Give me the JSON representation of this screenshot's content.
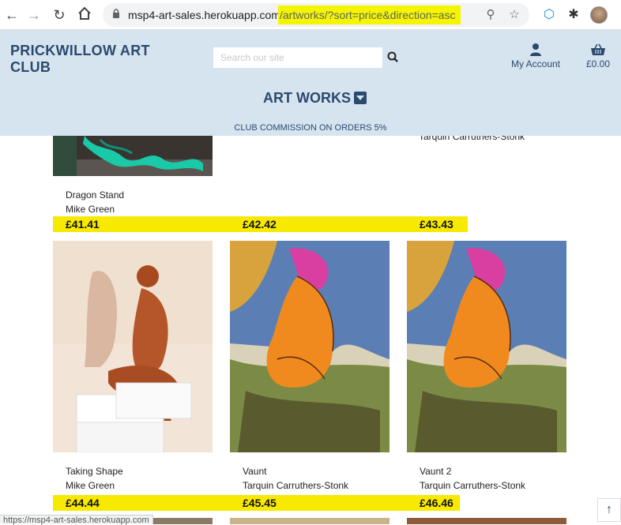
{
  "browser": {
    "url_host": "msp4-art-sales.herokuapp.com",
    "url_path": "/artworks/?sort=price&direction=asc",
    "status_url": "https://msp4-art-sales.herokuapp.com"
  },
  "header": {
    "logo": "PRICKWILLOW ART CLUB",
    "search_placeholder": "Search our site",
    "account_label": "My Account",
    "cart_total": "£0.00",
    "menu_label": "ART WORKS",
    "commission_banner": "CLUB COMMISSION ON ORDERS 5%"
  },
  "row1": {
    "partial_artist": "Tarquin Carruthers-Stonk",
    "cards": [
      {
        "title": "Dragon Stand",
        "artist": "Mike Green",
        "price": "£41.41"
      },
      {
        "title": "",
        "artist": "",
        "price": "£42.42"
      },
      {
        "title": "",
        "artist": "",
        "price": "£43.43"
      }
    ]
  },
  "row2": {
    "cards": [
      {
        "title": "Taking Shape",
        "artist": "Mike Green",
        "price": "£44.44"
      },
      {
        "title": "Vaunt",
        "artist": "Tarquin Carruthers-Stonk",
        "price": "£45.45"
      },
      {
        "title": "Vaunt 2",
        "artist": "Tarquin Carruthers-Stonk",
        "price": "£46.46"
      }
    ]
  },
  "colors": {
    "header_bg": "#d6e4f0",
    "brand_blue": "#2b4a6e",
    "price_highlight": "#f7ea00",
    "url_highlight": "#f5f500"
  },
  "icons": [
    "back-arrow-icon",
    "forward-arrow-icon",
    "reload-icon",
    "home-icon",
    "lock-icon",
    "zoom-icon",
    "star-icon",
    "extension-icon",
    "puzzle-icon",
    "search-icon",
    "user-icon",
    "basket-icon",
    "caret-down-icon",
    "arrow-up-icon"
  ]
}
